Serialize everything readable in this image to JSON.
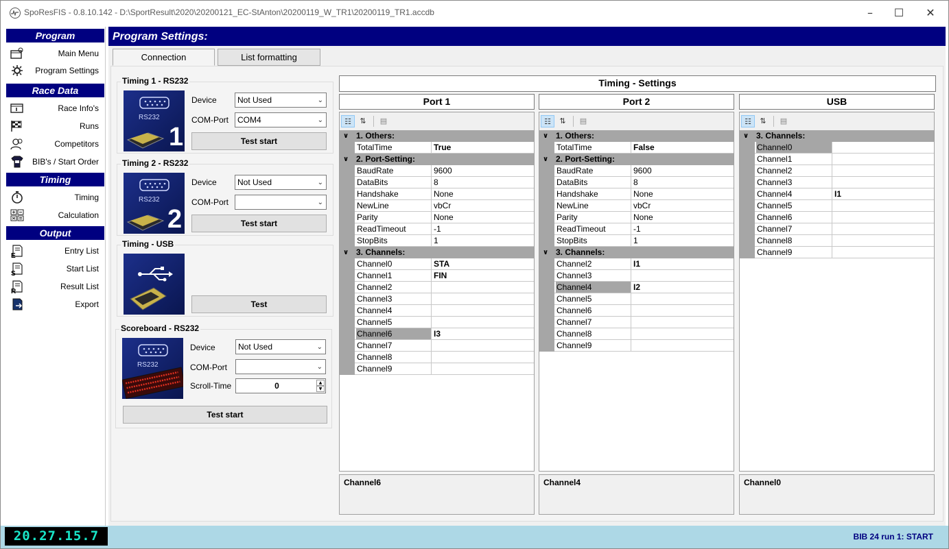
{
  "window": {
    "title": "SpoResFIS - 0.8.10.142 - D:\\SportResult\\2020\\20200121_EC-StAnton\\20200119_W_TR1\\20200119_TR1.accdb",
    "controls": [
      "minimize-icon",
      "maximize-icon",
      "close-icon"
    ]
  },
  "sidebar": {
    "sections": [
      {
        "title": "Program",
        "items": [
          {
            "label": "Main Menu",
            "icon": "main-menu-icon"
          },
          {
            "label": "Program Settings",
            "icon": "settings-icon"
          }
        ]
      },
      {
        "title": "Race Data",
        "items": [
          {
            "label": "Race Info's",
            "icon": "info-icon"
          },
          {
            "label": "Runs",
            "icon": "flag-icon"
          },
          {
            "label": "Competitors",
            "icon": "people-icon"
          },
          {
            "label": "BIB's / Start Order",
            "icon": "bib-icon"
          }
        ]
      },
      {
        "title": "Timing",
        "items": [
          {
            "label": "Timing",
            "icon": "stopwatch-icon"
          },
          {
            "label": "Calculation",
            "icon": "calculator-icon"
          }
        ]
      },
      {
        "title": "Output",
        "items": [
          {
            "label": "Entry List",
            "icon": "entry-list-icon"
          },
          {
            "label": "Start List",
            "icon": "start-list-icon"
          },
          {
            "label": "Result List",
            "icon": "result-list-icon"
          },
          {
            "label": "Export",
            "icon": "export-icon"
          }
        ]
      }
    ]
  },
  "header": {
    "title": "Program Settings:"
  },
  "tabs": [
    {
      "label": "Connection",
      "active": true
    },
    {
      "label": "List formatting",
      "active": false
    }
  ],
  "timing1": {
    "title": "Timing 1 - RS232",
    "device_label": "Device",
    "device_value": "Not Used",
    "com_label": "COM-Port",
    "com_value": "COM4",
    "button": "Test start",
    "image_text": "RS232",
    "image_number": "1"
  },
  "timing2": {
    "title": "Timing 2 - RS232",
    "device_label": "Device",
    "device_value": "Not Used",
    "com_label": "COM-Port",
    "com_value": "",
    "button": "Test start",
    "image_text": "RS232",
    "image_number": "2"
  },
  "timingUsb": {
    "title": "Timing - USB",
    "button": "Test"
  },
  "scoreboard": {
    "title": "Scoreboard - RS232",
    "device_label": "Device",
    "device_value": "Not Used",
    "com_label": "COM-Port",
    "com_value": "",
    "scroll_label": "Scroll-Time",
    "scroll_value": "0",
    "button": "Test start",
    "image_text": "RS232"
  },
  "timingSettings": {
    "title": "Timing - Settings",
    "panels": [
      {
        "name": "Port 1",
        "description": "Channel6",
        "rows": [
          {
            "type": "cat",
            "label": "1. Others:"
          },
          {
            "name": "TotalTime",
            "value": "True",
            "bold": true
          },
          {
            "type": "cat",
            "label": "2. Port-Setting:"
          },
          {
            "name": "BaudRate",
            "value": "9600"
          },
          {
            "name": "DataBits",
            "value": "8"
          },
          {
            "name": "Handshake",
            "value": "None"
          },
          {
            "name": "NewLine",
            "value": "vbCr"
          },
          {
            "name": "Parity",
            "value": "None"
          },
          {
            "name": "ReadTimeout",
            "value": "-1"
          },
          {
            "name": "StopBits",
            "value": "1"
          },
          {
            "type": "cat",
            "label": "3. Channels:"
          },
          {
            "name": "Channel0",
            "value": "STA",
            "bold": true
          },
          {
            "name": "Channel1",
            "value": "FIN",
            "bold": true
          },
          {
            "name": "Channel2",
            "value": ""
          },
          {
            "name": "Channel3",
            "value": ""
          },
          {
            "name": "Channel4",
            "value": ""
          },
          {
            "name": "Channel5",
            "value": ""
          },
          {
            "name": "Channel6",
            "value": "I3",
            "bold": true,
            "selected": true
          },
          {
            "name": "Channel7",
            "value": ""
          },
          {
            "name": "Channel8",
            "value": ""
          },
          {
            "name": "Channel9",
            "value": ""
          }
        ]
      },
      {
        "name": "Port 2",
        "description": "Channel4",
        "rows": [
          {
            "type": "cat",
            "label": "1. Others:"
          },
          {
            "name": "TotalTime",
            "value": "False",
            "bold": true
          },
          {
            "type": "cat",
            "label": "2. Port-Setting:"
          },
          {
            "name": "BaudRate",
            "value": "9600"
          },
          {
            "name": "DataBits",
            "value": "8"
          },
          {
            "name": "Handshake",
            "value": "None"
          },
          {
            "name": "NewLine",
            "value": "vbCr"
          },
          {
            "name": "Parity",
            "value": "None"
          },
          {
            "name": "ReadTimeout",
            "value": "-1"
          },
          {
            "name": "StopBits",
            "value": "1"
          },
          {
            "type": "cat",
            "label": "3. Channels:"
          },
          {
            "name": "Channel2",
            "value": "I1",
            "bold": true
          },
          {
            "name": "Channel3",
            "value": ""
          },
          {
            "name": "Channel4",
            "value": "I2",
            "bold": true,
            "selected": true
          },
          {
            "name": "Channel5",
            "value": ""
          },
          {
            "name": "Channel6",
            "value": ""
          },
          {
            "name": "Channel7",
            "value": ""
          },
          {
            "name": "Channel8",
            "value": ""
          },
          {
            "name": "Channel9",
            "value": ""
          }
        ]
      },
      {
        "name": "USB",
        "description": "Channel0",
        "rows": [
          {
            "type": "cat",
            "label": "3. Channels:"
          },
          {
            "name": "Channel0",
            "value": "",
            "selected": true
          },
          {
            "name": "Channel1",
            "value": ""
          },
          {
            "name": "Channel2",
            "value": ""
          },
          {
            "name": "Channel3",
            "value": ""
          },
          {
            "name": "Channel4",
            "value": "I1",
            "bold": true
          },
          {
            "name": "Channel5",
            "value": ""
          },
          {
            "name": "Channel6",
            "value": ""
          },
          {
            "name": "Channel7",
            "value": ""
          },
          {
            "name": "Channel8",
            "value": ""
          },
          {
            "name": "Channel9",
            "value": ""
          }
        ]
      }
    ]
  },
  "status": {
    "clock": "20.27.15.7",
    "text": "BIB 24 run 1: START"
  },
  "colors": {
    "header": "#000080",
    "status_bg": "#add8e6",
    "clock_fg": "#19e6c8",
    "category_bg": "#a6a6a6"
  }
}
